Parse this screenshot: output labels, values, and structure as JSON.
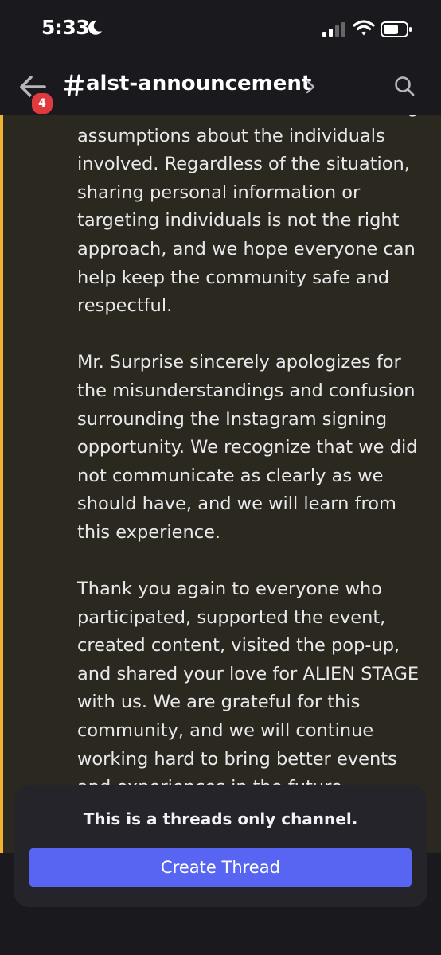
{
  "status": {
    "time": "5:33"
  },
  "header": {
    "badge": "4",
    "channel_name": "alst-announcement"
  },
  "message": {
    "paragraphs": [
      "information. Please also avoid making assumptions about the individuals involved. Regardless of the situation, sharing personal information or targeting individuals is not the right approach, and we hope everyone can help keep the community safe and respectful.",
      "Mr. Surprise sincerely apologizes for the misunderstandings and confusion surrounding the Instagram signing opportunity. We recognize that we did not communicate as clearly as we should have, and we will learn from this experience.",
      "Thank you again to everyone who participated, supported the event, created content, visited the pop-up, and shared your love for ALIEN STAGE with us. We are grateful for this community, and we will continue working hard to bring better events and experiences in the future."
    ]
  },
  "footer": {
    "notice": "This is a threads only channel.",
    "button_label": "Create Thread"
  },
  "colors": {
    "accent": "#f0b232",
    "button": "#5865f2",
    "badge": "#e0393e",
    "message_bg": "#2b2820"
  },
  "icons": [
    "moon-icon",
    "signal-icon",
    "wifi-icon",
    "battery-icon",
    "back-arrow-icon",
    "hash-icon",
    "chevron-right-icon",
    "search-icon"
  ]
}
